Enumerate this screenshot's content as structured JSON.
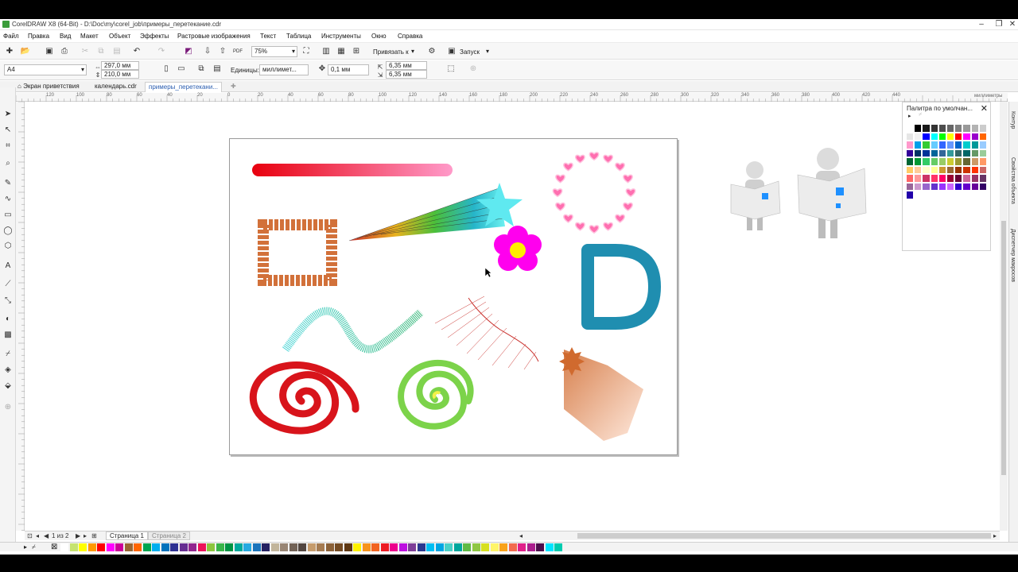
{
  "titlebar": {
    "title": "CorelDRAW X8 (64-Bit) - D:\\Doc\\my\\corel_job\\примеры_перетекание.cdr",
    "minimize_icon": "minimize-icon",
    "restore_icon": "restore-icon",
    "close_icon": "close-icon"
  },
  "menu": {
    "items": [
      "Файл",
      "Правка",
      "Вид",
      "Макет",
      "Объект",
      "Эффекты",
      "Растровые изображения",
      "Текст",
      "Таблица",
      "Инструменты",
      "Окно",
      "Справка"
    ]
  },
  "toolbar": {
    "zoom_value": "75%",
    "snap_label": "Привязать к",
    "launch_label": "Запуск",
    "icons": [
      "new-document-icon",
      "open-icon",
      "save-icon",
      "print-icon",
      "cut-icon",
      "copy-icon",
      "paste-icon",
      "undo-icon",
      "redo-icon",
      "search-content-icon",
      "import-icon",
      "export-icon",
      "publish-pdf-icon",
      "zoom-icon",
      "fullscreen-icon",
      "show-rulers-icon",
      "show-grid-icon",
      "show-guides-icon",
      "options-icon",
      "launch-icon"
    ]
  },
  "property_bar": {
    "page_size": "A4",
    "width": "297,0 мм",
    "height": "210,0 мм",
    "units_label": "Единицы:",
    "units_value": "миллимет...",
    "nudge_value": "0,1 мм",
    "dup_x": "6,35 мм",
    "dup_y": "6,35 мм"
  },
  "tabs": [
    {
      "label": "Экран приветствия",
      "active": false
    },
    {
      "label": "календарь.cdr",
      "active": false
    },
    {
      "label": "примеры_перетекани...",
      "active": true
    }
  ],
  "ruler": {
    "h_ticks": [
      "120",
      "100",
      "80",
      "60",
      "40",
      "20",
      "0",
      "20",
      "40",
      "60",
      "80",
      "100",
      "120",
      "140",
      "160",
      "180",
      "200",
      "220",
      "240",
      "260",
      "280",
      "300",
      "320",
      "340",
      "360",
      "380",
      "400",
      "420",
      "440"
    ],
    "units": "миллиметры"
  },
  "toolbox": {
    "tools": [
      "pick-tool-icon",
      "shape-tool-icon",
      "crop-tool-icon",
      "zoom-tool-icon",
      "freehand-tool-icon",
      "artistic-media-icon",
      "rectangle-tool-icon",
      "ellipse-tool-icon",
      "polygon-tool-icon",
      "text-tool-icon",
      "parallel-dimension-icon",
      "connector-tool-icon",
      "drop-shadow-icon",
      "transparency-icon",
      "eyedropper-icon",
      "interactive-fill-icon",
      "smart-fill-icon",
      "add-tool-icon"
    ]
  },
  "palette": {
    "title": "Палитра по умолчан...",
    "colors": [
      "#ffffff",
      "#000000",
      "#1a1a1a",
      "#333333",
      "#4d4d4d",
      "#666666",
      "#808080",
      "#999999",
      "#b3b3b3",
      "#cccccc",
      "#e6e6e6",
      "#f2f2f2",
      "#0000ff",
      "#00ffff",
      "#00ff00",
      "#ffff00",
      "#ff0000",
      "#ff00ff",
      "#9900cc",
      "#ff6600",
      "#ff99cc",
      "#00a0e9",
      "#33cc33",
      "#66ccff",
      "#3366ff",
      "#6699ff",
      "#0066cc",
      "#00cccc",
      "#009999",
      "#99ccff",
      "#330099",
      "#003366",
      "#003399",
      "#006699",
      "#336699",
      "#339999",
      "#336666",
      "#006666",
      "#669966",
      "#99cc99",
      "#006633",
      "#009933",
      "#33cc66",
      "#66cc66",
      "#99cc66",
      "#cccc33",
      "#999933",
      "#666633",
      "#cc9966",
      "#ff9966",
      "#ffcc66",
      "#ffcc99",
      "#ffffcc",
      "#ffff99",
      "#cc9933",
      "#996633",
      "#993300",
      "#cc3300",
      "#ff3300",
      "#cc6666",
      "#ff6666",
      "#ff9999",
      "#cc3366",
      "#ff3366",
      "#ff0066",
      "#990033",
      "#660033",
      "#cc6699",
      "#993366",
      "#663366",
      "#996699",
      "#cc99cc",
      "#9966cc",
      "#6633cc",
      "#9933ff",
      "#cc66ff",
      "#3300cc",
      "#6600cc",
      "#660099",
      "#330066",
      "#2200aa"
    ]
  },
  "side_tabs": [
    "Контур",
    "Свойства объекта",
    "Диспетчер макросов"
  ],
  "pagebar": {
    "page_counter": "1 из 2",
    "page1": "Страница 1",
    "page2": "Страница 2"
  },
  "colorbar": {
    "colors": [
      "#ffffff",
      "#c6e36f",
      "#ffff00",
      "#ff9900",
      "#ff0000",
      "#ff00ff",
      "#cc0099",
      "#996633",
      "#ff6600",
      "#00a651",
      "#00aeef",
      "#0072bc",
      "#2e3192",
      "#662d91",
      "#92278f",
      "#ed145b",
      "#8dc63f",
      "#39b54a",
      "#009444",
      "#00a99d",
      "#27aae1",
      "#1c75bc",
      "#262262",
      "#c2b59b",
      "#998675",
      "#736357",
      "#534741",
      "#c69c6d",
      "#a67c52",
      "#8c6239",
      "#754c24",
      "#603913",
      "#fff200",
      "#f7941d",
      "#f26522",
      "#ed1c24",
      "#ec008c",
      "#bd10e0",
      "#7f3f98",
      "#2b3990",
      "#00bff3",
      "#00a6e3",
      "#4ad1c8",
      "#00a79d",
      "#60bb46",
      "#8fc744",
      "#d7e021",
      "#fff568",
      "#f9a31a",
      "#f26c4f",
      "#e0218a",
      "#ab1f8e",
      "#4c0f4c",
      "#00e5ff",
      "#00ccb0"
    ]
  }
}
